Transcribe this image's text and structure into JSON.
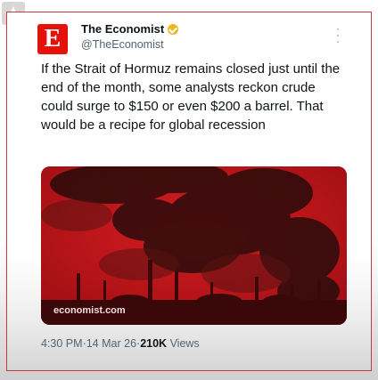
{
  "account": {
    "name": "The Economist",
    "handle": "@TheEconomist",
    "avatar_letter": "E",
    "avatar_color": "#e3120b",
    "verified_badge_color": "#e8b923"
  },
  "tweet": {
    "text": "If the Strait of Hormuz remains closed just until the end of the month, some analysts reckon crude could surge to $150 or even $200 a barrel. That would be a recipe for global recession",
    "media_caption": "economist.com",
    "time": "4:30 PM",
    "date": "14 Mar 26",
    "views_count": "210K",
    "views_label": "Views",
    "separator": " · "
  },
  "icons": {
    "more": "more-dots-icon",
    "verified": "verified-badge-icon"
  },
  "colors": {
    "card_border": "#c23b3b",
    "media_red": "#b8161a"
  }
}
